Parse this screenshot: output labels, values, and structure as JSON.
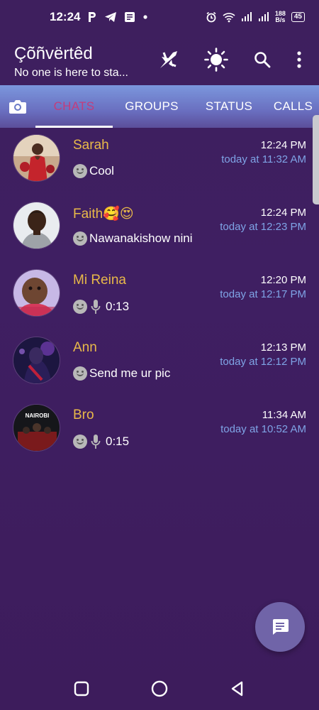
{
  "status_bar": {
    "time": "12:24",
    "net_speed_value": "188",
    "net_speed_unit": "B/s",
    "battery": "45"
  },
  "header": {
    "title": "Çõñvërtêd",
    "subtitle": "No one is here to sta..."
  },
  "tabs": [
    {
      "label": "CHATS",
      "active": true
    },
    {
      "label": "GROUPS",
      "active": false
    },
    {
      "label": "STATUS",
      "active": false
    },
    {
      "label": "CALLS",
      "active": false
    }
  ],
  "chats": [
    {
      "name": "Sarah",
      "time": "12:24 PM",
      "subtime": "today at 11:32 AM",
      "message": "Cool",
      "type": "text"
    },
    {
      "name": "Faith🥰😍",
      "time": "12:24 PM",
      "subtime": "today at 12:23 PM",
      "message": "Nawanakishow nini",
      "type": "text"
    },
    {
      "name": "Mi Reina",
      "time": "12:20 PM",
      "subtime": "today at 12:17 PM",
      "message": "0:13",
      "type": "voice"
    },
    {
      "name": "Ann",
      "time": "12:13 PM",
      "subtime": "today at 12:12 PM",
      "message": "Send me ur pic",
      "type": "text"
    },
    {
      "name": "Bro",
      "time": "11:34 AM",
      "subtime": "today at 10:52 AM",
      "message": "0:15",
      "type": "voice",
      "avatar_text": "NAIROBI"
    }
  ],
  "colors": {
    "name": "#e9b949",
    "subtime": "#7fa4e6",
    "active_tab": "#c33c7c",
    "fab": "#7064a8"
  }
}
